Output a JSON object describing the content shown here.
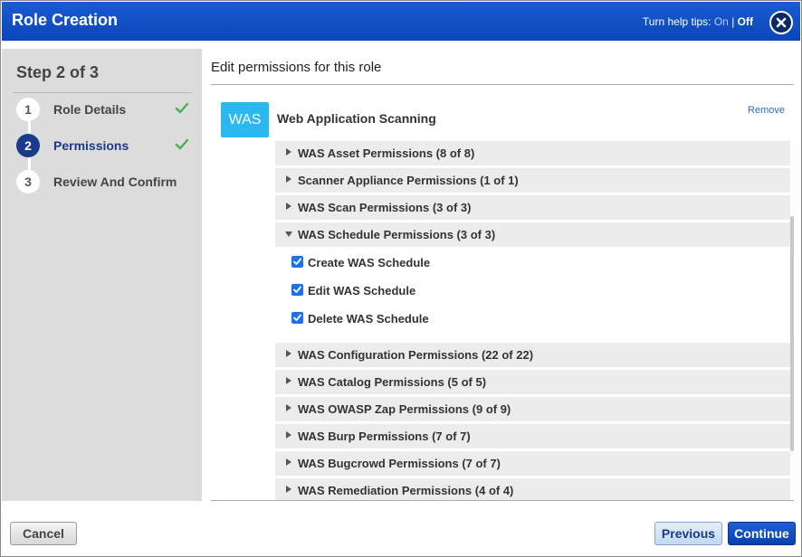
{
  "window": {
    "title": "Role Creation"
  },
  "help_tips": {
    "label": "Turn help tips:",
    "on": "On",
    "separator": "|",
    "off": "Off"
  },
  "wizard": {
    "heading": "Step 2 of 3",
    "steps": [
      {
        "number": "1",
        "label": "Role Details",
        "complete": true,
        "active": false
      },
      {
        "number": "2",
        "label": "Permissions",
        "complete": true,
        "active": true
      },
      {
        "number": "3",
        "label": "Review And Confirm",
        "complete": false,
        "active": false
      }
    ]
  },
  "main": {
    "title": "Edit permissions for this role",
    "module": {
      "badge": "WAS",
      "name": "Web Application Scanning",
      "remove_label": "Remove"
    },
    "permission_groups": [
      {
        "label": "WAS Asset Permissions (8 of 8)",
        "expanded": false
      },
      {
        "label": "Scanner Appliance Permissions (1 of 1)",
        "expanded": false
      },
      {
        "label": "WAS Scan Permissions (3 of 3)",
        "expanded": false
      },
      {
        "label": "WAS Schedule Permissions (3 of 3)",
        "expanded": true,
        "items": [
          {
            "label": "Create WAS Schedule",
            "checked": true
          },
          {
            "label": "Edit WAS Schedule",
            "checked": true
          },
          {
            "label": "Delete WAS Schedule",
            "checked": true
          }
        ]
      },
      {
        "label": "WAS Configuration Permissions (22 of 22)",
        "expanded": false
      },
      {
        "label": "WAS Catalog Permissions (5 of 5)",
        "expanded": false
      },
      {
        "label": "WAS OWASP Zap Permissions (9 of 9)",
        "expanded": false
      },
      {
        "label": "WAS Burp Permissions (7 of 7)",
        "expanded": false
      },
      {
        "label": "WAS Bugcrowd Permissions (7 of 7)",
        "expanded": false
      },
      {
        "label": "WAS Remediation Permissions (4 of 4)",
        "expanded": false
      }
    ]
  },
  "footer": {
    "cancel_label": "Cancel",
    "previous_label": "Previous",
    "continue_label": "Continue"
  },
  "colors": {
    "title_bar": "#0b46b8",
    "accent": "#1a3a8c",
    "was_badge": "#29b8f0",
    "check_green": "#4caf50",
    "link_blue": "#2a6cc4"
  },
  "icons": {
    "close": "close-icon",
    "check": "checkmark-icon",
    "expand": "caret-right-icon",
    "collapse": "caret-down-icon",
    "checkbox": "checkbox-checked-icon"
  }
}
